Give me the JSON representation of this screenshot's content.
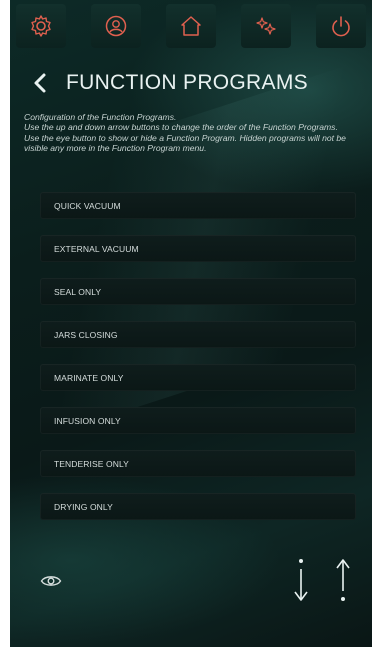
{
  "topbar": {
    "icons": [
      "gear-icon",
      "user-icon",
      "home-icon",
      "sparkle-icon",
      "power-icon"
    ]
  },
  "header": {
    "title": "FUNCTION PROGRAMS"
  },
  "description": {
    "line1": "Configuration of the Function Programs.",
    "line2": "Use the up and down arrow buttons to change the order of the Function Programs.",
    "line3": "Use the eye button to show or hide a Function Program.  Hidden programs will not be visible any more in the Function Program menu."
  },
  "programs": [
    {
      "label": "QUICK VACUUM"
    },
    {
      "label": "EXTERNAL VACUUM"
    },
    {
      "label": "SEAL ONLY"
    },
    {
      "label": "JARS CLOSING"
    },
    {
      "label": "MARINATE ONLY"
    },
    {
      "label": "INFUSION ONLY"
    },
    {
      "label": "TENDERISE ONLY"
    },
    {
      "label": "DRYING ONLY"
    }
  ],
  "colors": {
    "accent_red": "#e0604f",
    "text_light": "#e9f2f1",
    "background": "#0b1e1c"
  }
}
